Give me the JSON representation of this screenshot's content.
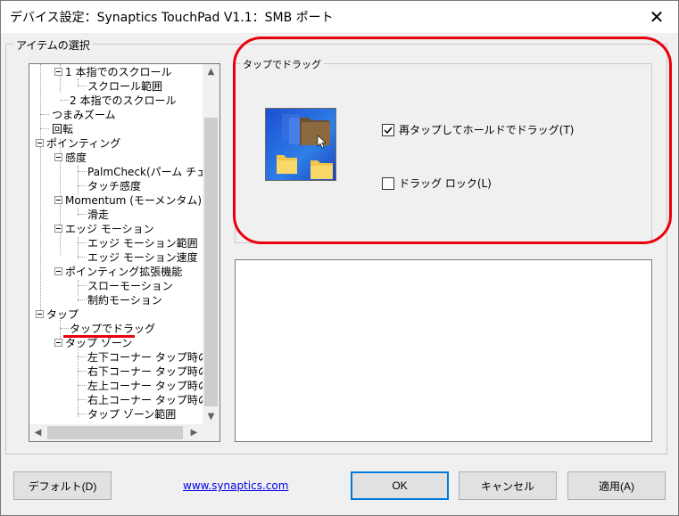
{
  "window": {
    "title": "デバイス設定：Synaptics TouchPad V1.1：SMB ポート",
    "close_icon": "close-icon"
  },
  "item_select": {
    "label": "アイテムの選択",
    "tree": [
      {
        "label": "1 本指でのスクロール"
      },
      {
        "label": "スクロール範囲"
      },
      {
        "label": "2 本指でのスクロール"
      },
      {
        "label": "つまみズーム"
      },
      {
        "label": "回転"
      },
      {
        "label": "ポインティング"
      },
      {
        "label": "感度"
      },
      {
        "label": "PalmCheck(パーム チェック)"
      },
      {
        "label": "タッチ感度"
      },
      {
        "label": "Momentum (モーメンタム)"
      },
      {
        "label": "滑走"
      },
      {
        "label": "エッジ モーション"
      },
      {
        "label": "エッジ モーション範囲"
      },
      {
        "label": "エッジ モーション速度"
      },
      {
        "label": "ポインティング拡張機能"
      },
      {
        "label": "スローモーション"
      },
      {
        "label": "制約モーション"
      },
      {
        "label": "タップ"
      },
      {
        "label": "タップでドラッグ"
      },
      {
        "label": "タップ ゾーン"
      },
      {
        "label": "左下コーナー タップ時の動作"
      },
      {
        "label": "右下コーナー タップ時の動作"
      },
      {
        "label": "左上コーナー タップ時の動作"
      },
      {
        "label": "右上コーナー タップ時の動作"
      },
      {
        "label": "タップ ゾーン範囲"
      }
    ]
  },
  "settings": {
    "group_label": "タップでドラッグ",
    "retap_hold": {
      "label": "再タップしてホールドでドラッグ(T)",
      "checked": true
    },
    "drag_lock": {
      "label": "ドラッグ ロック(L)",
      "checked": false
    }
  },
  "footer": {
    "default_button": "デフォルト(D)",
    "link": "www.synaptics.com",
    "ok_button": "OK",
    "cancel_button": "キャンセル",
    "apply_button": "適用(A)"
  },
  "colors": {
    "highlight": "#e8000d",
    "accent": "#0078d7",
    "link": "#0000ee"
  }
}
